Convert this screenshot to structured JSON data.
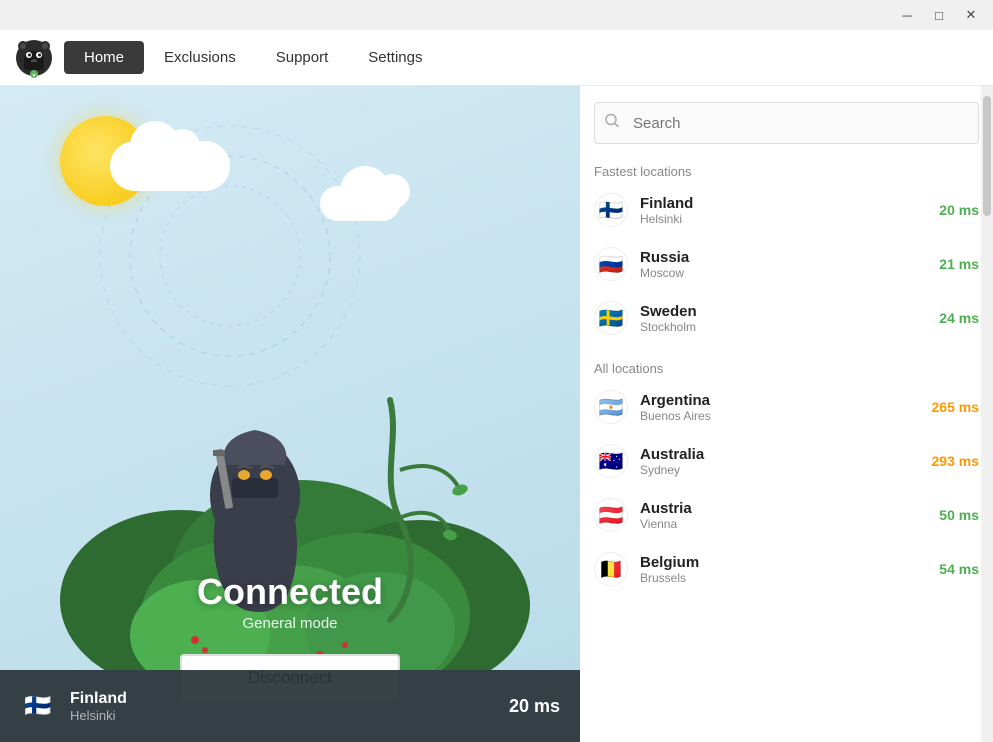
{
  "titlebar": {
    "minimize_label": "─",
    "maximize_label": "□",
    "close_label": "✕"
  },
  "nav": {
    "logo_alt": "TunnelBear Logo",
    "items": [
      {
        "id": "home",
        "label": "Home",
        "active": true
      },
      {
        "id": "exclusions",
        "label": "Exclusions",
        "active": false
      },
      {
        "id": "support",
        "label": "Support",
        "active": false
      },
      {
        "id": "settings",
        "label": "Settings",
        "active": false
      }
    ]
  },
  "main": {
    "status": "Connected",
    "mode": "General mode",
    "disconnect_label": "Disconnect"
  },
  "bottom_bar": {
    "country": "Finland",
    "city": "Helsinki",
    "ms": "20 ms",
    "flag": "🇫🇮"
  },
  "search": {
    "placeholder": "Search"
  },
  "fastest_locations": {
    "label": "Fastest locations",
    "items": [
      {
        "country": "Finland",
        "city": "Helsinki",
        "ms": "20 ms",
        "ms_color": "green",
        "flag": "🇫🇮"
      },
      {
        "country": "Russia",
        "city": "Moscow",
        "ms": "21 ms",
        "ms_color": "green",
        "flag": "🇷🇺"
      },
      {
        "country": "Sweden",
        "city": "Stockholm",
        "ms": "24 ms",
        "ms_color": "green",
        "flag": "🇸🇪"
      }
    ]
  },
  "all_locations": {
    "label": "All locations",
    "items": [
      {
        "country": "Argentina",
        "city": "Buenos Aires",
        "ms": "265 ms",
        "ms_color": "orange",
        "flag": "🇦🇷"
      },
      {
        "country": "Australia",
        "city": "Sydney",
        "ms": "293 ms",
        "ms_color": "orange",
        "flag": "🇦🇺"
      },
      {
        "country": "Austria",
        "city": "Vienna",
        "ms": "50 ms",
        "ms_color": "green",
        "flag": "🇦🇹"
      },
      {
        "country": "Belgium",
        "city": "Brussels",
        "ms": "54 ms",
        "ms_color": "green",
        "flag": "🇧🇪"
      }
    ]
  },
  "colors": {
    "background_gradient_start": "#d4ebf5",
    "background_gradient_end": "#b8dbe8",
    "nav_active_bg": "#3a3a3a",
    "bottom_bar_bg": "#2c3538"
  }
}
